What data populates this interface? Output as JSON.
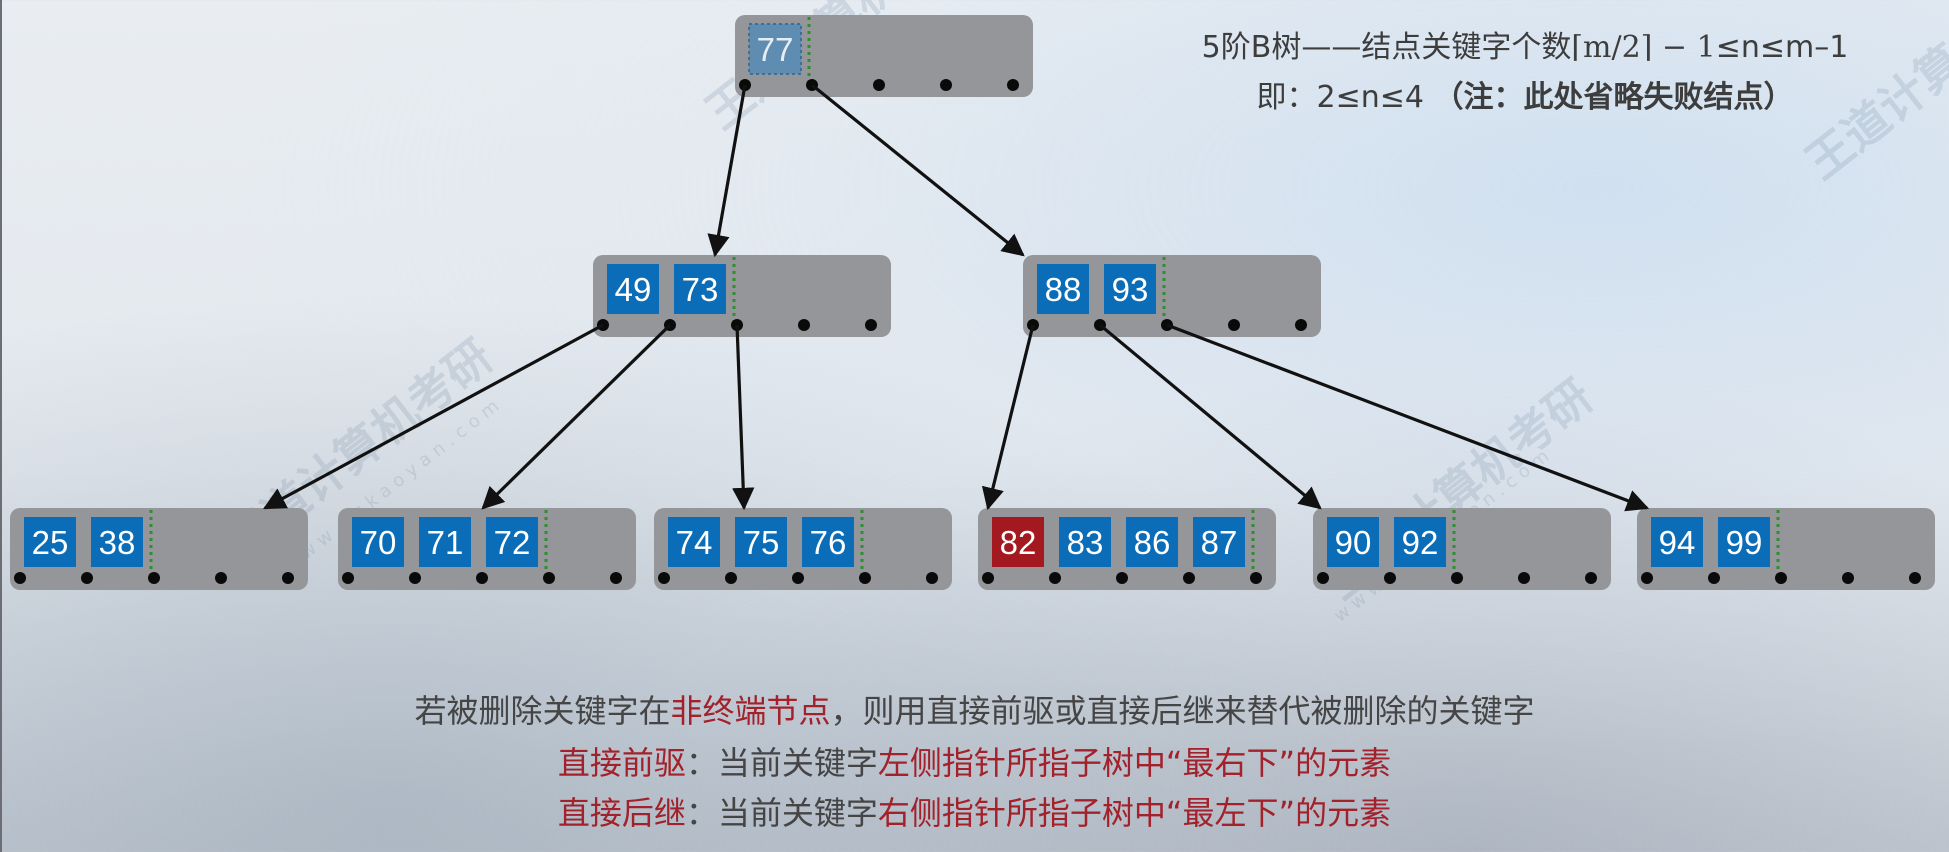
{
  "title": {
    "line1_prefix": "5阶B树——结点关键字个数",
    "line1_formula": "⌈m/2⌉ − 1",
    "line1_suffix": "≤n≤m–1",
    "line2_prefix": "即：2≤n≤4 ",
    "line2_note": "（注：此处省略失败结点）"
  },
  "tree": {
    "node_fill": "#94969a",
    "key_fill": "#0b6db7",
    "highlight_fill": "#a3191f",
    "faded_key_fill": "#5f8db1",
    "divider_color": "#2f8f2f",
    "edge_color": "#111111",
    "nodes": [
      {
        "id": "root",
        "keys": [
          "77"
        ],
        "key_styles": [
          "faded"
        ]
      },
      {
        "id": "n49_73",
        "keys": [
          "49",
          "73"
        ],
        "key_styles": [
          "normal",
          "normal"
        ]
      },
      {
        "id": "n88_93",
        "keys": [
          "88",
          "93"
        ],
        "key_styles": [
          "normal",
          "normal"
        ]
      },
      {
        "id": "leaf_25_38",
        "keys": [
          "25",
          "38"
        ],
        "key_styles": [
          "normal",
          "normal"
        ]
      },
      {
        "id": "leaf_70_71_72",
        "keys": [
          "70",
          "71",
          "72"
        ],
        "key_styles": [
          "normal",
          "normal",
          "normal"
        ]
      },
      {
        "id": "leaf_74_75_76",
        "keys": [
          "74",
          "75",
          "76"
        ],
        "key_styles": [
          "normal",
          "normal",
          "normal"
        ]
      },
      {
        "id": "leaf_82_83_86_87",
        "keys": [
          "82",
          "83",
          "86",
          "87"
        ],
        "key_styles": [
          "highlight",
          "normal",
          "normal",
          "normal"
        ]
      },
      {
        "id": "leaf_90_92",
        "keys": [
          "90",
          "92"
        ],
        "key_styles": [
          "normal",
          "normal"
        ]
      },
      {
        "id": "leaf_94_99",
        "keys": [
          "94",
          "99"
        ],
        "key_styles": [
          "normal",
          "normal"
        ]
      }
    ],
    "edges": [
      {
        "from": "root",
        "pointer": 0,
        "to": "n49_73"
      },
      {
        "from": "root",
        "pointer": 1,
        "to": "n88_93"
      },
      {
        "from": "n49_73",
        "pointer": 0,
        "to": "leaf_25_38"
      },
      {
        "from": "n49_73",
        "pointer": 1,
        "to": "leaf_70_71_72"
      },
      {
        "from": "n49_73",
        "pointer": 2,
        "to": "leaf_74_75_76"
      },
      {
        "from": "n88_93",
        "pointer": 0,
        "to": "leaf_82_83_86_87"
      },
      {
        "from": "n88_93",
        "pointer": 1,
        "to": "leaf_90_92"
      },
      {
        "from": "n88_93",
        "pointer": 2,
        "to": "leaf_94_99"
      }
    ]
  },
  "notes": {
    "line1_a": "若被删除关键字在",
    "line1_red": "非终端节点",
    "line1_b": "，则用直接前驱或直接后继来替代被删除的关键字",
    "line2_label": "直接前驱",
    "line2_a": "：当前关键字",
    "line2_red": "左侧指针所指子树中“最右下”的元素",
    "line3_label": "直接后继",
    "line3_a": "：当前关键字",
    "line3_red": "右侧指针所指子树中“最左下”的元素"
  },
  "watermark": {
    "text": "王道计算机考研",
    "url": "www.cskaoyan.com"
  }
}
